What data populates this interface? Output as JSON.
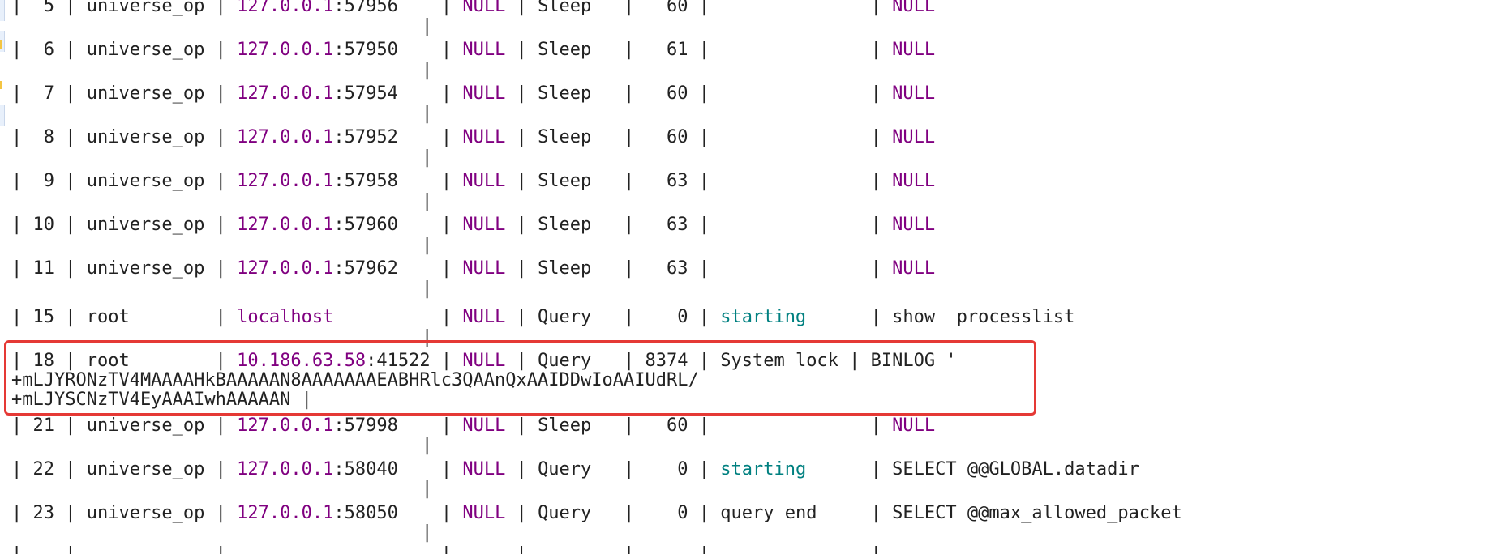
{
  "terminal": {
    "rows": [
      {
        "pre": "|  5 | universe_op | ",
        "host": "127.0.0.1",
        "port": ":57956",
        "mid": "    | ",
        "db": "NULL",
        "mid2": " | Sleep   |   60 |               | ",
        "info": "NULL",
        "info_class": "kw"
      },
      {
        "pre": "|  6 | universe_op | ",
        "host": "127.0.0.1",
        "port": ":57950",
        "mid": "    | ",
        "db": "NULL",
        "mid2": " | Sleep   |   61 |               | ",
        "info": "NULL",
        "info_class": "kw"
      },
      {
        "pre": "|  7 | universe_op | ",
        "host": "127.0.0.1",
        "port": ":57954",
        "mid": "    | ",
        "db": "NULL",
        "mid2": " | Sleep   |   60 |               | ",
        "info": "NULL",
        "info_class": "kw"
      },
      {
        "pre": "|  8 | universe_op | ",
        "host": "127.0.0.1",
        "port": ":57952",
        "mid": "    | ",
        "db": "NULL",
        "mid2": " | Sleep   |   60 |               | ",
        "info": "NULL",
        "info_class": "kw"
      },
      {
        "pre": "|  9 | universe_op | ",
        "host": "127.0.0.1",
        "port": ":57958",
        "mid": "    | ",
        "db": "NULL",
        "mid2": " | Sleep   |   63 |               | ",
        "info": "NULL",
        "info_class": "kw"
      },
      {
        "pre": "| 10 | universe_op | ",
        "host": "127.0.0.1",
        "port": ":57960",
        "mid": "    | ",
        "db": "NULL",
        "mid2": " | Sleep   |   63 |               | ",
        "info": "NULL",
        "info_class": "kw"
      },
      {
        "pre": "| 11 | universe_op | ",
        "host": "127.0.0.1",
        "port": ":57962",
        "mid": "    | ",
        "db": "NULL",
        "mid2": " | Sleep   |   63 |               | ",
        "info": "NULL",
        "info_class": "kw"
      }
    ],
    "row15": {
      "pre": "| 15 | root        | ",
      "host": "localhost",
      "mid": "          | ",
      "db": "NULL",
      "mid2": " | Query   |    0 | ",
      "state": "starting",
      "mid3": "      | ",
      "info": "show  processlist"
    },
    "row18": {
      "pre": "| 18 | root        | ",
      "host": "10.186.63.58",
      "port": ":41522",
      "mid": " | ",
      "db": "NULL",
      "rest": " | Query   | 8374 | System lock | BINLOG '",
      "line2": "+mLJYRONzTV4MAAAAHkBAAAAAN8AAAAAAAEABHRlc3QAAnQxAAIDDwIoAAIUdRL/",
      "line3": "+mLJYSCNzTV4EyAAAIwhAAAAAN |"
    },
    "row21": {
      "pre": "| 21 | universe_op | ",
      "host": "127.0.0.1",
      "port": ":57998",
      "mid": "    | ",
      "db": "NULL",
      "mid2": " | Sleep   |   60 |               | ",
      "info": "NULL"
    },
    "row22": {
      "pre": "| 22 | universe_op | ",
      "host": "127.0.0.1",
      "port": ":58040",
      "mid": "    | ",
      "db": "NULL",
      "mid2": " | Query   |    0 | ",
      "state": "starting",
      "mid3": "      | ",
      "info": "SELECT @@GLOBAL.datadir"
    },
    "row23": {
      "pre": "| 23 | universe_op | ",
      "host": "127.0.0.1",
      "port": ":58050",
      "mid": "    | ",
      "db": "NULL",
      "mid2": " | Query   |    0 | ",
      "state": "query end",
      "mid3": "     | ",
      "info": "SELECT @@max_allowed_packet"
    },
    "separator": "|",
    "bottom_rule": "|    |             |                    |      |         |      |               |"
  },
  "colors": {
    "host": "#800080",
    "null": "#800080",
    "state": "#008080",
    "highlight": "#e53935"
  }
}
